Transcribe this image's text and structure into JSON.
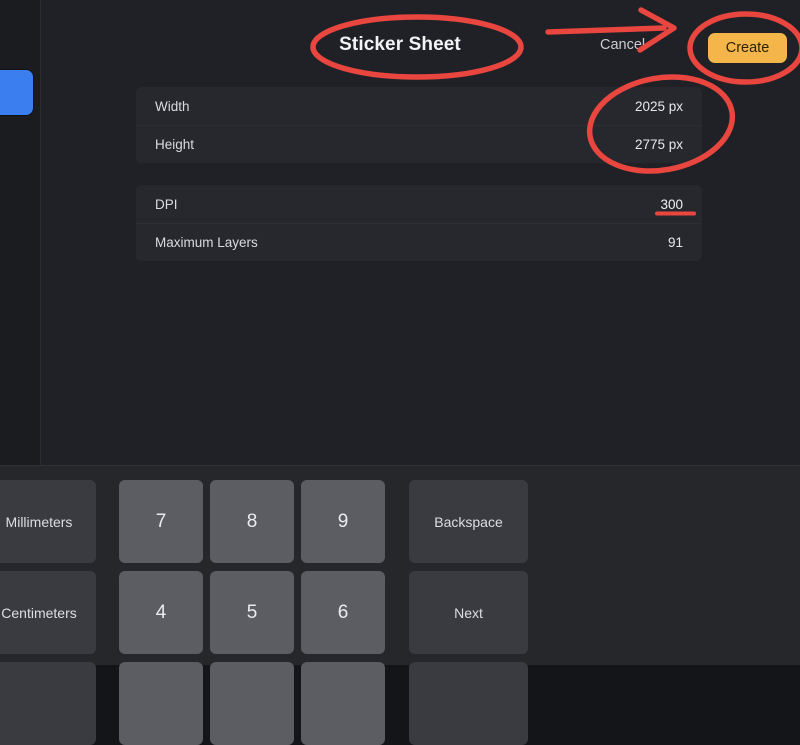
{
  "window": {
    "background_color": "#202126",
    "side_strip_color": "#1b1c20",
    "accent_color": "#f4b64a",
    "annotation_color": "#e8463f",
    "swatch_color": "#3b7ef0"
  },
  "header": {
    "title": "Sticker Sheet",
    "cancel_label": "Cancel",
    "create_label": "Create"
  },
  "settings": {
    "group_a": [
      {
        "label": "Width",
        "value": "2025 px"
      },
      {
        "label": "Height",
        "value": "2775 px"
      }
    ],
    "group_b": [
      {
        "label": "DPI",
        "value": "300"
      },
      {
        "label": "Maximum Layers",
        "value": "91"
      }
    ]
  },
  "annotations": [
    {
      "name": "ellipse-title",
      "target": "Sticker Sheet"
    },
    {
      "name": "arrow-to-create",
      "target": "Create"
    },
    {
      "name": "ellipse-create",
      "target": "Create"
    },
    {
      "name": "ellipse-dimensions",
      "target": "2025 px / 2775 px"
    },
    {
      "name": "underline-dpi",
      "target": "300"
    }
  ],
  "keyboard": {
    "units": [
      {
        "label": "Millimeters"
      },
      {
        "label": "Centimeters"
      }
    ],
    "rows": [
      {
        "keys": [
          "7",
          "8",
          "9"
        ],
        "action": "Backspace"
      },
      {
        "keys": [
          "4",
          "5",
          "6"
        ],
        "action": "Next"
      }
    ]
  }
}
